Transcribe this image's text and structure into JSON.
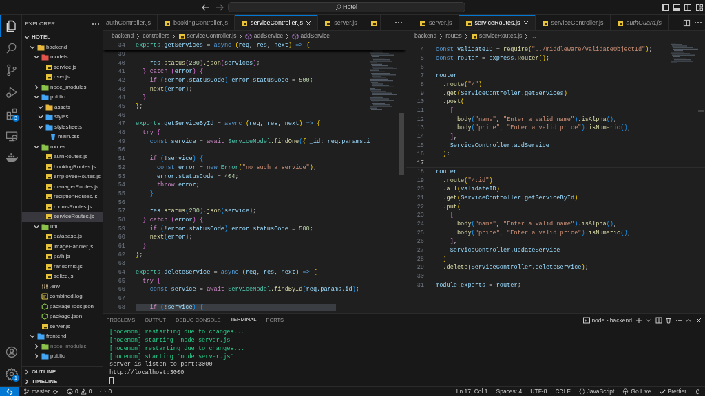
{
  "title_bar": {
    "search": "Hotel"
  },
  "activity_bar": {
    "items": [
      {
        "kind": "explorer",
        "selected": true
      },
      {
        "kind": "search",
        "selected": false
      },
      {
        "kind": "source-control",
        "selected": false
      },
      {
        "kind": "run-debug",
        "selected": false
      },
      {
        "kind": "extensions",
        "selected": false,
        "badge": "3"
      },
      {
        "kind": "remote",
        "selected": false
      },
      {
        "kind": "docker",
        "selected": false
      }
    ],
    "bottom": [
      {
        "kind": "account"
      },
      {
        "kind": "settings",
        "badge": "1"
      }
    ]
  },
  "explorer": {
    "title": "EXPLORER",
    "workspace": "HOTEL",
    "tree": [
      {
        "label": "backend",
        "kind": "folder",
        "color": "#e8b83e",
        "expanded": true,
        "selected": false,
        "dimmed": false,
        "children": [
          {
            "label": "models",
            "kind": "folder",
            "color": "#e5534b",
            "expanded": true,
            "selected": false,
            "dimmed": false,
            "children": [
              {
                "label": "service.js",
                "kind": "js",
                "selected": false,
                "dimmed": false
              },
              {
                "label": "user.js",
                "kind": "js",
                "selected": false,
                "dimmed": false
              }
            ]
          },
          {
            "label": "node_modules",
            "kind": "folder",
            "color": "#8bc34a",
            "expanded": false,
            "selected": false,
            "dimmed": false
          },
          {
            "label": "public",
            "kind": "folder",
            "color": "#42a5f5",
            "expanded": true,
            "selected": false,
            "dimmed": false,
            "children": [
              {
                "label": "assets",
                "kind": "folder",
                "color": "#e8b83e",
                "expanded": true,
                "selected": false,
                "dimmed": false
              },
              {
                "label": "styles",
                "kind": "folder",
                "color": "#42a5f5",
                "expanded": true,
                "selected": false,
                "dimmed": false
              },
              {
                "label": "stylesheets",
                "kind": "folder",
                "color": "#42a5f5",
                "expanded": true,
                "selected": false,
                "dimmed": false,
                "children": [
                  {
                    "label": "main.css",
                    "kind": "css",
                    "selected": false,
                    "dimmed": false
                  }
                ]
              }
            ]
          },
          {
            "label": "routes",
            "kind": "folder",
            "color": "#8bc34a",
            "expanded": true,
            "selected": false,
            "dimmed": false,
            "children": [
              {
                "label": "authRoutes.js",
                "kind": "js",
                "selected": false,
                "dimmed": false
              },
              {
                "label": "bookingRoutes.js",
                "kind": "js",
                "selected": false,
                "dimmed": false
              },
              {
                "label": "employeeRoutes.js",
                "kind": "js",
                "selected": false,
                "dimmed": false
              },
              {
                "label": "managerRoutes.js",
                "kind": "js",
                "selected": false,
                "dimmed": false
              },
              {
                "label": "reciptionRoutes.js",
                "kind": "js",
                "selected": false,
                "dimmed": false
              },
              {
                "label": "roomsRoutes.js",
                "kind": "js",
                "selected": false,
                "dimmed": false
              },
              {
                "label": "serviceRoutes.js",
                "kind": "js",
                "selected": true,
                "dimmed": false
              }
            ]
          },
          {
            "label": "util",
            "kind": "folder",
            "color": "#8bc34a",
            "expanded": true,
            "selected": false,
            "dimmed": false,
            "children": [
              {
                "label": "database.js",
                "kind": "js",
                "selected": false,
                "dimmed": false
              },
              {
                "label": "imageHandler.js",
                "kind": "js",
                "selected": false,
                "dimmed": false
              },
              {
                "label": "path.js",
                "kind": "js",
                "selected": false,
                "dimmed": false
              },
              {
                "label": "randomId.js",
                "kind": "js",
                "selected": false,
                "dimmed": false
              },
              {
                "label": "sqlize.js",
                "kind": "js",
                "selected": false,
                "dimmed": false
              }
            ]
          },
          {
            "label": ".env",
            "kind": "env",
            "selected": false,
            "dimmed": false
          },
          {
            "label": "combined.log",
            "kind": "log",
            "selected": false,
            "dimmed": false
          },
          {
            "label": "package-lock.json",
            "kind": "json",
            "selected": false,
            "dimmed": false
          },
          {
            "label": "package.json",
            "kind": "json",
            "selected": false,
            "dimmed": false
          },
          {
            "label": "server.js",
            "kind": "js",
            "selected": false,
            "dimmed": false
          }
        ]
      },
      {
        "label": "frontend",
        "kind": "folder",
        "color": "#42a5f5",
        "expanded": true,
        "selected": false,
        "dimmed": false,
        "children": [
          {
            "label": "node_modules",
            "kind": "folder",
            "color": "#8bc34a",
            "expanded": false,
            "selected": false,
            "dimmed": true
          },
          {
            "label": "public",
            "kind": "folder",
            "color": "#42a5f5",
            "expanded": false,
            "selected": false,
            "dimmed": false
          }
        ]
      }
    ],
    "sections": [
      {
        "label": "OUTLINE",
        "expanded": false
      },
      {
        "label": "TIMELINE",
        "expanded": false
      }
    ]
  },
  "editors": [
    {
      "tabs": [
        {
          "label": "authController.js",
          "selected": false,
          "preview": false
        },
        {
          "label": "bookingController.js",
          "kind": "js",
          "selected": false,
          "preview": false
        },
        {
          "label": "serviceController.js",
          "kind": "js",
          "selected": true,
          "preview": false
        },
        {
          "label": "server.js",
          "kind": "js",
          "selected": false,
          "preview": false
        },
        {
          "kind": "js",
          "selected": false
        }
      ],
      "breadcrumbs": [
        {
          "label": "backend",
          "kind": "folder"
        },
        {
          "label": "controllers",
          "kind": "folder"
        },
        {
          "label": "serviceController.js",
          "kind": "js"
        },
        {
          "label": "addService",
          "kind": "symbol"
        },
        {
          "label": "addService",
          "kind": "symbol"
        }
      ],
      "sticky": {
        "number": "34",
        "tokens": [
          {
            "text": "exports",
            "kind": "type"
          },
          {
            "text": ".getServices",
            "kind": "variable"
          },
          {
            "text": " =",
            "kind": "plain"
          },
          {
            "text": " async",
            "kind": "keyword"
          },
          {
            "text": " (",
            "kind": "bracket1"
          },
          {
            "text": "req",
            "kind": "variable"
          },
          {
            "text": ",",
            "kind": "plain"
          },
          {
            "text": " res",
            "kind": "variable"
          },
          {
            "text": ",",
            "kind": "plain"
          },
          {
            "text": " next",
            "kind": "variable"
          },
          {
            "text": ")",
            "kind": "bracket1"
          },
          {
            "text": " =>",
            "kind": "keyword"
          },
          {
            "text": " {",
            "kind": "bracket1"
          }
        ]
      },
      "lines": [
        {
          "number": "39"
        },
        {
          "number": "40",
          "tokens": [
            {
              "text": "    res",
              "kind": "variable"
            },
            {
              "text": ".status",
              "kind": "function"
            },
            {
              "text": "(",
              "kind": "bracket2"
            },
            {
              "text": "200",
              "kind": "number"
            },
            {
              "text": ")",
              "kind": "bracket2"
            },
            {
              "text": ".json",
              "kind": "function"
            },
            {
              "text": "(",
              "kind": "bracket2"
            },
            {
              "text": "services",
              "kind": "variable"
            },
            {
              "text": ")",
              "kind": "bracket2"
            },
            {
              "text": ";",
              "kind": "plain"
            }
          ]
        },
        {
          "number": "41",
          "tokens": [
            {
              "text": "  }",
              "kind": "bracket2"
            },
            {
              "text": " catch",
              "kind": "control"
            },
            {
              "text": " (",
              "kind": "bracket2"
            },
            {
              "text": "error",
              "kind": "variable"
            },
            {
              "text": ")",
              "kind": "bracket2"
            },
            {
              "text": " {",
              "kind": "bracket2"
            }
          ]
        },
        {
          "number": "42",
          "tokens": [
            {
              "text": "    if",
              "kind": "control"
            },
            {
              "text": " (",
              "kind": "bracket3"
            },
            {
              "text": "!",
              "kind": "plain"
            },
            {
              "text": "error.statusCode",
              "kind": "variable"
            },
            {
              "text": ")",
              "kind": "bracket3"
            },
            {
              "text": " error.statusCode",
              "kind": "variable"
            },
            {
              "text": " =",
              "kind": "plain"
            },
            {
              "text": " 500",
              "kind": "number"
            },
            {
              "text": ";",
              "kind": "plain"
            }
          ]
        },
        {
          "number": "43",
          "tokens": [
            {
              "text": "    next",
              "kind": "function"
            },
            {
              "text": "(",
              "kind": "bracket3"
            },
            {
              "text": "error",
              "kind": "variable"
            },
            {
              "text": ")",
              "kind": "bracket3"
            },
            {
              "text": ";",
              "kind": "plain"
            }
          ]
        },
        {
          "number": "44",
          "tokens": [
            {
              "text": "  }",
              "kind": "bracket2"
            }
          ]
        },
        {
          "number": "45",
          "tokens": [
            {
              "text": "}",
              "kind": "bracket1"
            },
            {
              "text": ";",
              "kind": "plain"
            }
          ]
        },
        {
          "number": "46"
        },
        {
          "number": "47",
          "tokens": [
            {
              "text": "exports",
              "kind": "type"
            },
            {
              "text": ".getServiceById",
              "kind": "variable"
            },
            {
              "text": " =",
              "kind": "plain"
            },
            {
              "text": " async",
              "kind": "keyword"
            },
            {
              "text": " (",
              "kind": "bracket1"
            },
            {
              "text": "req",
              "kind": "variable"
            },
            {
              "text": ",",
              "kind": "plain"
            },
            {
              "text": " res",
              "kind": "variable"
            },
            {
              "text": ",",
              "kind": "plain"
            },
            {
              "text": " next",
              "kind": "variable"
            },
            {
              "text": ")",
              "kind": "bracket1"
            },
            {
              "text": " =>",
              "kind": "keyword"
            },
            {
              "text": " {",
              "kind": "bracket1"
            }
          ]
        },
        {
          "number": "48",
          "tokens": [
            {
              "text": "  try",
              "kind": "control"
            },
            {
              "text": " {",
              "kind": "bracket2"
            }
          ]
        },
        {
          "number": "49",
          "tokens": [
            {
              "text": "    const",
              "kind": "keyword"
            },
            {
              "text": " service",
              "kind": "variable"
            },
            {
              "text": " =",
              "kind": "plain"
            },
            {
              "text": " await",
              "kind": "control"
            },
            {
              "text": " ServiceModel",
              "kind": "type"
            },
            {
              "text": ".findOne",
              "kind": "function"
            },
            {
              "text": "(",
              "kind": "bracket3"
            },
            {
              "text": "{",
              "kind": "bracket1"
            },
            {
              "text": " _id",
              "kind": "variable"
            },
            {
              "text": ":",
              "kind": "plain"
            },
            {
              "text": " req.params.i",
              "kind": "variable"
            }
          ]
        },
        {
          "number": "50"
        },
        {
          "number": "51",
          "tokens": [
            {
              "text": "    if",
              "kind": "control"
            },
            {
              "text": " (",
              "kind": "bracket3"
            },
            {
              "text": "!",
              "kind": "plain"
            },
            {
              "text": "service",
              "kind": "variable"
            },
            {
              "text": ")",
              "kind": "bracket3"
            },
            {
              "text": " {",
              "kind": "bracket3"
            }
          ]
        },
        {
          "number": "52",
          "tokens": [
            {
              "text": "      const",
              "kind": "keyword"
            },
            {
              "text": " error",
              "kind": "variable"
            },
            {
              "text": " =",
              "kind": "plain"
            },
            {
              "text": " new",
              "kind": "keyword"
            },
            {
              "text": " Error",
              "kind": "type"
            },
            {
              "text": "(",
              "kind": "bracket1"
            },
            {
              "text": "\"no such a service\"",
              "kind": "string"
            },
            {
              "text": ")",
              "kind": "bracket1"
            },
            {
              "text": ";",
              "kind": "plain"
            }
          ]
        },
        {
          "number": "53",
          "tokens": [
            {
              "text": "      error.statusCode",
              "kind": "variable"
            },
            {
              "text": " =",
              "kind": "plain"
            },
            {
              "text": " 404",
              "kind": "number"
            },
            {
              "text": ";",
              "kind": "plain"
            }
          ]
        },
        {
          "number": "54",
          "tokens": [
            {
              "text": "      throw",
              "kind": "control"
            },
            {
              "text": " error",
              "kind": "variable"
            },
            {
              "text": ";",
              "kind": "plain"
            }
          ]
        },
        {
          "number": "55",
          "tokens": [
            {
              "text": "    }",
              "kind": "bracket3"
            }
          ]
        },
        {
          "number": "56"
        },
        {
          "number": "57",
          "tokens": [
            {
              "text": "    res",
              "kind": "variable"
            },
            {
              "text": ".status",
              "kind": "function"
            },
            {
              "text": "(",
              "kind": "bracket3"
            },
            {
              "text": "200",
              "kind": "number"
            },
            {
              "text": ")",
              "kind": "bracket3"
            },
            {
              "text": ".json",
              "kind": "function"
            },
            {
              "text": "(",
              "kind": "bracket3"
            },
            {
              "text": "service",
              "kind": "variable"
            },
            {
              "text": ")",
              "kind": "bracket3"
            },
            {
              "text": ";",
              "kind": "plain"
            }
          ]
        },
        {
          "number": "58",
          "tokens": [
            {
              "text": "  }",
              "kind": "bracket2"
            },
            {
              "text": " catch",
              "kind": "control"
            },
            {
              "text": " (",
              "kind": "bracket2"
            },
            {
              "text": "error",
              "kind": "variable"
            },
            {
              "text": ")",
              "kind": "bracket2"
            },
            {
              "text": " {",
              "kind": "bracket2"
            }
          ]
        },
        {
          "number": "59",
          "tokens": [
            {
              "text": "    if",
              "kind": "control"
            },
            {
              "text": " (",
              "kind": "bracket3"
            },
            {
              "text": "!",
              "kind": "plain"
            },
            {
              "text": "error.statusCode",
              "kind": "variable"
            },
            {
              "text": ")",
              "kind": "bracket3"
            },
            {
              "text": " error.statusCode",
              "kind": "variable"
            },
            {
              "text": " =",
              "kind": "plain"
            },
            {
              "text": " 500",
              "kind": "number"
            },
            {
              "text": ";",
              "kind": "plain"
            }
          ]
        },
        {
          "number": "60",
          "tokens": [
            {
              "text": "    next",
              "kind": "function"
            },
            {
              "text": "(",
              "kind": "bracket3"
            },
            {
              "text": "error",
              "kind": "variable"
            },
            {
              "text": ")",
              "kind": "bracket3"
            },
            {
              "text": ";",
              "kind": "plain"
            }
          ]
        },
        {
          "number": "61",
          "tokens": [
            {
              "text": "  }",
              "kind": "bracket2"
            }
          ]
        },
        {
          "number": "62",
          "tokens": [
            {
              "text": "}",
              "kind": "bracket1"
            },
            {
              "text": ";",
              "kind": "plain"
            }
          ]
        },
        {
          "number": "63"
        },
        {
          "number": "64",
          "tokens": [
            {
              "text": "exports",
              "kind": "type"
            },
            {
              "text": ".deleteService",
              "kind": "variable"
            },
            {
              "text": " =",
              "kind": "plain"
            },
            {
              "text": " async",
              "kind": "keyword"
            },
            {
              "text": " (",
              "kind": "bracket1"
            },
            {
              "text": "req",
              "kind": "variable"
            },
            {
              "text": ",",
              "kind": "plain"
            },
            {
              "text": " res",
              "kind": "variable"
            },
            {
              "text": ",",
              "kind": "plain"
            },
            {
              "text": " next",
              "kind": "variable"
            },
            {
              "text": ")",
              "kind": "bracket1"
            },
            {
              "text": " =>",
              "kind": "keyword"
            },
            {
              "text": " {",
              "kind": "bracket1"
            }
          ]
        },
        {
          "number": "65",
          "tokens": [
            {
              "text": "  try",
              "kind": "control"
            },
            {
              "text": " {",
              "kind": "bracket2"
            }
          ]
        },
        {
          "number": "66",
          "tokens": [
            {
              "text": "    const",
              "kind": "keyword"
            },
            {
              "text": " service",
              "kind": "variable"
            },
            {
              "text": " =",
              "kind": "plain"
            },
            {
              "text": " await",
              "kind": "control"
            },
            {
              "text": " ServiceModel",
              "kind": "type"
            },
            {
              "text": ".findById",
              "kind": "function"
            },
            {
              "text": "(",
              "kind": "bracket3"
            },
            {
              "text": "req.params.id",
              "kind": "variable"
            },
            {
              "text": ")",
              "kind": "bracket3"
            },
            {
              "text": ";",
              "kind": "plain"
            }
          ]
        },
        {
          "number": "67"
        },
        {
          "number": "68",
          "highlighted": true,
          "tokens": [
            {
              "text": "    if",
              "kind": "control"
            },
            {
              "text": " (",
              "kind": "bracket3"
            },
            {
              "text": "!",
              "kind": "plain"
            },
            {
              "text": "service",
              "kind": "variable"
            },
            {
              "text": ")",
              "kind": "bracket3"
            },
            {
              "text": " {",
              "kind": "bracket3"
            }
          ]
        }
      ]
    },
    {
      "tabs": [
        {
          "label": "server.js",
          "kind": "js",
          "selected": false,
          "preview": false
        },
        {
          "label": "serviceRoutes.js",
          "kind": "js",
          "selected": true,
          "preview": false
        },
        {
          "label": "serviceController.js",
          "kind": "js",
          "selected": false,
          "preview": false
        },
        {
          "label": "authGuard.js",
          "kind": "js",
          "selected": false,
          "preview": true
        }
      ],
      "breadcrumbs": [
        {
          "label": "backend",
          "kind": "folder"
        },
        {
          "label": "routes",
          "kind": "folder"
        },
        {
          "label": "serviceRoutes.js",
          "kind": "js"
        },
        {
          "label": "...",
          "kind": "folder"
        }
      ],
      "lines": [
        {
          "number": "4",
          "tokens": [
            {
              "text": "const",
              "kind": "keyword"
            },
            {
              "text": " validateID",
              "kind": "variable"
            },
            {
              "text": " =",
              "kind": "plain"
            },
            {
              "text": " require",
              "kind": "function"
            },
            {
              "text": "(",
              "kind": "bracket1"
            },
            {
              "text": "\"../middleware/validateObjectId\"",
              "kind": "string"
            },
            {
              "text": ")",
              "kind": "bracket1"
            },
            {
              "text": ";",
              "kind": "plain"
            }
          ]
        },
        {
          "number": "5",
          "tokens": [
            {
              "text": "const",
              "kind": "keyword"
            },
            {
              "text": " router",
              "kind": "variable"
            },
            {
              "text": " =",
              "kind": "plain"
            },
            {
              "text": " express",
              "kind": "variable"
            },
            {
              "text": ".Router",
              "kind": "function"
            },
            {
              "text": "(",
              "kind": "bracket1"
            },
            {
              "text": ")",
              "kind": "bracket1"
            },
            {
              "text": ";",
              "kind": "plain"
            }
          ]
        },
        {
          "number": "6"
        },
        {
          "number": "7",
          "tokens": [
            {
              "text": "router",
              "kind": "variable"
            }
          ]
        },
        {
          "number": "8",
          "tokens": [
            {
              "text": "  .route",
              "kind": "function"
            },
            {
              "text": "(",
              "kind": "bracket1"
            },
            {
              "text": "\"/\"",
              "kind": "string"
            },
            {
              "text": ")",
              "kind": "bracket1"
            }
          ]
        },
        {
          "number": "9",
          "tokens": [
            {
              "text": "  .get",
              "kind": "function"
            },
            {
              "text": "(",
              "kind": "bracket1"
            },
            {
              "text": "ServiceController.getServices",
              "kind": "variable"
            },
            {
              "text": ")",
              "kind": "bracket1"
            }
          ]
        },
        {
          "number": "10",
          "tokens": [
            {
              "text": "  .post",
              "kind": "function"
            },
            {
              "text": "(",
              "kind": "bracket1"
            }
          ]
        },
        {
          "number": "11",
          "tokens": [
            {
              "text": "    [",
              "kind": "bracket2"
            }
          ]
        },
        {
          "number": "12",
          "tokens": [
            {
              "text": "      body",
              "kind": "function"
            },
            {
              "text": "(",
              "kind": "bracket3"
            },
            {
              "text": "\"name\"",
              "kind": "string"
            },
            {
              "text": ",",
              "kind": "plain"
            },
            {
              "text": " \"Enter a valid name\"",
              "kind": "string"
            },
            {
              "text": ")",
              "kind": "bracket3"
            },
            {
              "text": ".isAlpha",
              "kind": "function"
            },
            {
              "text": "()",
              "kind": "bracket3"
            },
            {
              "text": ",",
              "kind": "plain"
            }
          ]
        },
        {
          "number": "13",
          "tokens": [
            {
              "text": "      body",
              "kind": "function"
            },
            {
              "text": "(",
              "kind": "bracket3"
            },
            {
              "text": "\"price\"",
              "kind": "string"
            },
            {
              "text": ",",
              "kind": "plain"
            },
            {
              "text": " \"Enter a valid price\"",
              "kind": "string"
            },
            {
              "text": ")",
              "kind": "bracket3"
            },
            {
              "text": ".isNumeric",
              "kind": "function"
            },
            {
              "text": "()",
              "kind": "bracket3"
            },
            {
              "text": ",",
              "kind": "plain"
            }
          ]
        },
        {
          "number": "14",
          "tokens": [
            {
              "text": "    ]",
              "kind": "bracket2"
            },
            {
              "text": ",",
              "kind": "plain"
            }
          ]
        },
        {
          "number": "15",
          "tokens": [
            {
              "text": "    ServiceController.addService",
              "kind": "variable"
            }
          ]
        },
        {
          "number": "16",
          "tokens": [
            {
              "text": "  )",
              "kind": "bracket1"
            },
            {
              "text": ";",
              "kind": "plain"
            }
          ]
        },
        {
          "number": "17",
          "current": true
        },
        {
          "number": "18",
          "tokens": [
            {
              "text": "router",
              "kind": "variable"
            }
          ]
        },
        {
          "number": "19",
          "tokens": [
            {
              "text": "  .route",
              "kind": "function"
            },
            {
              "text": "(",
              "kind": "bracket1"
            },
            {
              "text": "\"/:id\"",
              "kind": "string"
            },
            {
              "text": ")",
              "kind": "bracket1"
            }
          ]
        },
        {
          "number": "20",
          "tokens": [
            {
              "text": "  .all",
              "kind": "function"
            },
            {
              "text": "(",
              "kind": "bracket1"
            },
            {
              "text": "validateID",
              "kind": "variable"
            },
            {
              "text": ")",
              "kind": "bracket1"
            }
          ]
        },
        {
          "number": "21",
          "tokens": [
            {
              "text": "  .get",
              "kind": "function"
            },
            {
              "text": "(",
              "kind": "bracket1"
            },
            {
              "text": "ServiceController.getServiceById",
              "kind": "variable"
            },
            {
              "text": ")",
              "kind": "bracket1"
            }
          ]
        },
        {
          "number": "22",
          "tokens": [
            {
              "text": "  .put",
              "kind": "function"
            },
            {
              "text": "(",
              "kind": "bracket1"
            }
          ]
        },
        {
          "number": "23",
          "tokens": [
            {
              "text": "    [",
              "kind": "bracket2"
            }
          ]
        },
        {
          "number": "24",
          "tokens": [
            {
              "text": "      body",
              "kind": "function"
            },
            {
              "text": "(",
              "kind": "bracket3"
            },
            {
              "text": "\"name\"",
              "kind": "string"
            },
            {
              "text": ",",
              "kind": "plain"
            },
            {
              "text": " \"Enter a valid name\"",
              "kind": "string"
            },
            {
              "text": ")",
              "kind": "bracket3"
            },
            {
              "text": ".isAlpha",
              "kind": "function"
            },
            {
              "text": "()",
              "kind": "bracket3"
            },
            {
              "text": ",",
              "kind": "plain"
            }
          ]
        },
        {
          "number": "25",
          "tokens": [
            {
              "text": "      body",
              "kind": "function"
            },
            {
              "text": "(",
              "kind": "bracket3"
            },
            {
              "text": "\"price\"",
              "kind": "string"
            },
            {
              "text": ",",
              "kind": "plain"
            },
            {
              "text": " \"Enter a valid price\"",
              "kind": "string"
            },
            {
              "text": ")",
              "kind": "bracket3"
            },
            {
              "text": ".isNumeric",
              "kind": "function"
            },
            {
              "text": "()",
              "kind": "bracket3"
            },
            {
              "text": ",",
              "kind": "plain"
            }
          ]
        },
        {
          "number": "26",
          "tokens": [
            {
              "text": "    ]",
              "kind": "bracket2"
            },
            {
              "text": ",",
              "kind": "plain"
            }
          ]
        },
        {
          "number": "27",
          "tokens": [
            {
              "text": "    ServiceController.updateService",
              "kind": "variable"
            }
          ]
        },
        {
          "number": "28",
          "tokens": [
            {
              "text": "  )",
              "kind": "bracket1"
            }
          ]
        },
        {
          "number": "29",
          "tokens": [
            {
              "text": "  .delete",
              "kind": "function"
            },
            {
              "text": "(",
              "kind": "bracket1"
            },
            {
              "text": "ServiceController.deleteService",
              "kind": "variable"
            },
            {
              "text": ")",
              "kind": "bracket1"
            },
            {
              "text": ";",
              "kind": "plain"
            }
          ]
        },
        {
          "number": "30"
        },
        {
          "number": "31",
          "tokens": [
            {
              "text": "module.exports",
              "kind": "variable"
            },
            {
              "text": " =",
              "kind": "plain"
            },
            {
              "text": " router",
              "kind": "variable"
            },
            {
              "text": ";",
              "kind": "plain"
            }
          ]
        }
      ]
    }
  ],
  "panel": {
    "tabs": [
      {
        "label": "PROBLEMS",
        "selected": false
      },
      {
        "label": "OUTPUT",
        "selected": false
      },
      {
        "label": "DEBUG CONSOLE",
        "selected": false
      },
      {
        "label": "TERMINAL",
        "selected": true
      },
      {
        "label": "PORTS",
        "selected": false
      }
    ],
    "terminal_name": "node - backend",
    "lines": [
      {
        "text": "[nodemon] restarting due to changes...",
        "kind": "nodemon"
      },
      {
        "text": "[nodemon] starting `node server.js`",
        "kind": "nodemon"
      },
      {
        "text": "[nodemon] restarting due to changes...",
        "kind": "nodemon"
      },
      {
        "text": "[nodemon] starting `node server.js`",
        "kind": "nodemon"
      },
      {
        "text": "server is listen to port:3000",
        "kind": "output"
      },
      {
        "text": "http://localhost:3000",
        "kind": "output"
      }
    ]
  },
  "status_bar": {
    "branch": "master",
    "errors": "0",
    "warnings": "0",
    "ports": "0",
    "position": "Ln 17, Col 1",
    "indentation": "Spaces: 4",
    "encoding": "UTF-8",
    "eol": "CRLF",
    "language": "JavaScript",
    "go_live": "Go Live",
    "formatter": "Prettier"
  }
}
